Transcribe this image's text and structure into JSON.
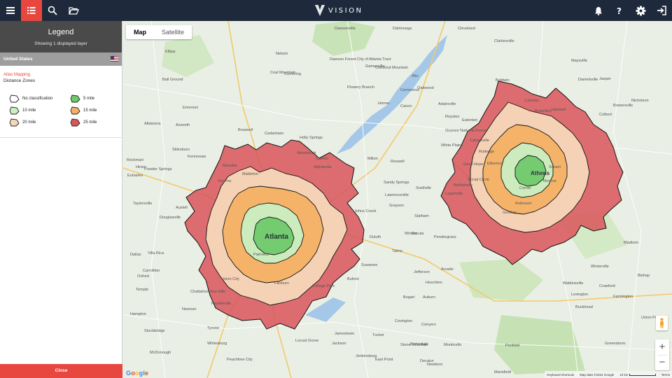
{
  "app": {
    "brand": "VISION"
  },
  "topbar": {
    "icons": [
      "menu-icon",
      "list-icon",
      "search-icon",
      "folder-open-icon",
      "bell-icon",
      "help-icon",
      "settings-icon",
      "logout-icon"
    ]
  },
  "legend": {
    "title": "Legend",
    "subtitle": "Showing 1 displayed layer",
    "country": "United States",
    "group_link": "Atlas Mapping",
    "group_name": "Distance Zones",
    "items": [
      {
        "label": "No classification",
        "color": "#ffffff"
      },
      {
        "label": "5 mile",
        "color": "#6fc96b"
      },
      {
        "label": "10 mile",
        "color": "#c9efc3"
      },
      {
        "label": "15 mile",
        "color": "#f4b166"
      },
      {
        "label": "20 mile",
        "color": "#f6d8b8"
      },
      {
        "label": "25 mile",
        "color": "#d9555a"
      }
    ],
    "close_label": "Close"
  },
  "map": {
    "type_buttons": {
      "map": "Map",
      "satellite": "Satellite"
    },
    "zoom_in": "+",
    "zoom_out": "−",
    "google": "Google",
    "attribution": {
      "shortcuts": "Keyboard shortcuts",
      "data": "Map data ©2024 Google",
      "scale": "10 km",
      "terms": "Terms"
    },
    "cities": {
      "atlanta": "Atlanta",
      "athens": "Athens"
    },
    "towns": [
      "Dawsonville",
      "Dahlonega",
      "Cleveland",
      "Clarkesville",
      "Ellijay",
      "Nelson",
      "Dawson Forest City of Atlanta Tract",
      "Alto",
      "Baldwin",
      "Jasper",
      "Ball Ground",
      "Coal Mountain",
      "Cumming",
      "Gainesville",
      "Oakwood",
      "Chestnut Mountain",
      "Braselton",
      "Flowery Branch",
      "Commerce",
      "Homer",
      "Canon",
      "Royston",
      "Lavonia",
      "Hartwell",
      "Bowersville",
      "Maysville",
      "Nicholson",
      "Danielsville",
      "Colbert",
      "Elberton",
      "Comer",
      "Winterville",
      "Crawford",
      "Lexington",
      "Watkinsville",
      "Bishop",
      "Farmington",
      "Madison",
      "Buckhead",
      "Greensboro",
      "Union Point",
      "Penfield",
      "Siloam",
      "Robinson",
      "Godfrey",
      "Eatonton",
      "Oconee National Forest",
      "White Plains",
      "Cartersville",
      "Adairsville",
      "Emerson",
      "Allatoona",
      "Acworth",
      "Kennesaw",
      "Marietta",
      "Smyrna",
      "Mableton",
      "Austell",
      "Douglasville",
      "Villa Rica",
      "Dallas",
      "Hiram",
      "Powder Springs",
      "Euharlee",
      "Stilesboro",
      "Taylorsville",
      "Rockmart",
      "Braswell",
      "Cedartown",
      "Holly Springs",
      "Woodstock",
      "Canton",
      "Alpharetta",
      "Milton",
      "Roswell",
      "Sandy Springs",
      "Johns Creek",
      "Duluth",
      "Suwanee",
      "Buford",
      "Dacula",
      "Lawrenceville",
      "Grayson",
      "Snellville",
      "Loganville",
      "Monroe",
      "Social Circle",
      "Rutledge",
      "Good Hope",
      "Bethlehem",
      "Statham",
      "Winder",
      "Jefferson",
      "Arcade",
      "Talmo",
      "Pendergrass",
      "Hoschton",
      "Auburn",
      "Bogart",
      "Conyers",
      "Covington",
      "Stone Mountain",
      "Tucker",
      "Decatur",
      "East Point",
      "College Park",
      "Fairburn",
      "Palmetto",
      "Union City",
      "Fayetteville",
      "Peachtree City",
      "Tyrone",
      "Newnan",
      "Chattahoochee Hills",
      "Whitesburg",
      "Carrollton",
      "Temple",
      "Hampton",
      "Stockbridge",
      "McDonough",
      "Locust Grove",
      "Jackson",
      "Jenkinsburg",
      "Monticello",
      "Mansfield",
      "Newborn",
      "Porterdale",
      "Oxford",
      "Jamestown",
      "Almon",
      "Walnut Grove",
      "Jersey",
      "Fairplay",
      "Sunny Side",
      "Blacksville",
      "Barnesville",
      "Jenkinsburg",
      "Hillsboro",
      "Forsyth"
    ]
  }
}
